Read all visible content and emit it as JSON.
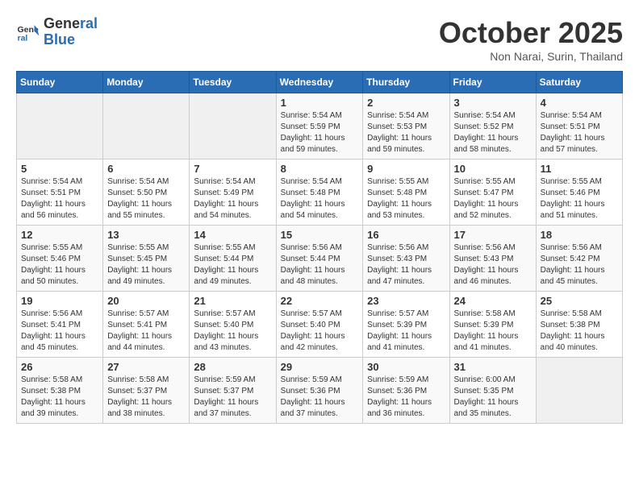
{
  "logo": {
    "line1": "General",
    "line2": "Blue"
  },
  "title": "October 2025",
  "subtitle": "Non Narai, Surin, Thailand",
  "headers": [
    "Sunday",
    "Monday",
    "Tuesday",
    "Wednesday",
    "Thursday",
    "Friday",
    "Saturday"
  ],
  "weeks": [
    [
      {
        "day": "",
        "sunrise": "",
        "sunset": "",
        "daylight": ""
      },
      {
        "day": "",
        "sunrise": "",
        "sunset": "",
        "daylight": ""
      },
      {
        "day": "",
        "sunrise": "",
        "sunset": "",
        "daylight": ""
      },
      {
        "day": "1",
        "sunrise": "Sunrise: 5:54 AM",
        "sunset": "Sunset: 5:59 PM",
        "daylight": "Daylight: 11 hours and 59 minutes."
      },
      {
        "day": "2",
        "sunrise": "Sunrise: 5:54 AM",
        "sunset": "Sunset: 5:53 PM",
        "daylight": "Daylight: 11 hours and 59 minutes."
      },
      {
        "day": "3",
        "sunrise": "Sunrise: 5:54 AM",
        "sunset": "Sunset: 5:52 PM",
        "daylight": "Daylight: 11 hours and 58 minutes."
      },
      {
        "day": "4",
        "sunrise": "Sunrise: 5:54 AM",
        "sunset": "Sunset: 5:51 PM",
        "daylight": "Daylight: 11 hours and 57 minutes."
      }
    ],
    [
      {
        "day": "5",
        "sunrise": "Sunrise: 5:54 AM",
        "sunset": "Sunset: 5:51 PM",
        "daylight": "Daylight: 11 hours and 56 minutes."
      },
      {
        "day": "6",
        "sunrise": "Sunrise: 5:54 AM",
        "sunset": "Sunset: 5:50 PM",
        "daylight": "Daylight: 11 hours and 55 minutes."
      },
      {
        "day": "7",
        "sunrise": "Sunrise: 5:54 AM",
        "sunset": "Sunset: 5:49 PM",
        "daylight": "Daylight: 11 hours and 54 minutes."
      },
      {
        "day": "8",
        "sunrise": "Sunrise: 5:54 AM",
        "sunset": "Sunset: 5:48 PM",
        "daylight": "Daylight: 11 hours and 54 minutes."
      },
      {
        "day": "9",
        "sunrise": "Sunrise: 5:55 AM",
        "sunset": "Sunset: 5:48 PM",
        "daylight": "Daylight: 11 hours and 53 minutes."
      },
      {
        "day": "10",
        "sunrise": "Sunrise: 5:55 AM",
        "sunset": "Sunset: 5:47 PM",
        "daylight": "Daylight: 11 hours and 52 minutes."
      },
      {
        "day": "11",
        "sunrise": "Sunrise: 5:55 AM",
        "sunset": "Sunset: 5:46 PM",
        "daylight": "Daylight: 11 hours and 51 minutes."
      }
    ],
    [
      {
        "day": "12",
        "sunrise": "Sunrise: 5:55 AM",
        "sunset": "Sunset: 5:46 PM",
        "daylight": "Daylight: 11 hours and 50 minutes."
      },
      {
        "day": "13",
        "sunrise": "Sunrise: 5:55 AM",
        "sunset": "Sunset: 5:45 PM",
        "daylight": "Daylight: 11 hours and 49 minutes."
      },
      {
        "day": "14",
        "sunrise": "Sunrise: 5:55 AM",
        "sunset": "Sunset: 5:44 PM",
        "daylight": "Daylight: 11 hours and 49 minutes."
      },
      {
        "day": "15",
        "sunrise": "Sunrise: 5:56 AM",
        "sunset": "Sunset: 5:44 PM",
        "daylight": "Daylight: 11 hours and 48 minutes."
      },
      {
        "day": "16",
        "sunrise": "Sunrise: 5:56 AM",
        "sunset": "Sunset: 5:43 PM",
        "daylight": "Daylight: 11 hours and 47 minutes."
      },
      {
        "day": "17",
        "sunrise": "Sunrise: 5:56 AM",
        "sunset": "Sunset: 5:43 PM",
        "daylight": "Daylight: 11 hours and 46 minutes."
      },
      {
        "day": "18",
        "sunrise": "Sunrise: 5:56 AM",
        "sunset": "Sunset: 5:42 PM",
        "daylight": "Daylight: 11 hours and 45 minutes."
      }
    ],
    [
      {
        "day": "19",
        "sunrise": "Sunrise: 5:56 AM",
        "sunset": "Sunset: 5:41 PM",
        "daylight": "Daylight: 11 hours and 45 minutes."
      },
      {
        "day": "20",
        "sunrise": "Sunrise: 5:57 AM",
        "sunset": "Sunset: 5:41 PM",
        "daylight": "Daylight: 11 hours and 44 minutes."
      },
      {
        "day": "21",
        "sunrise": "Sunrise: 5:57 AM",
        "sunset": "Sunset: 5:40 PM",
        "daylight": "Daylight: 11 hours and 43 minutes."
      },
      {
        "day": "22",
        "sunrise": "Sunrise: 5:57 AM",
        "sunset": "Sunset: 5:40 PM",
        "daylight": "Daylight: 11 hours and 42 minutes."
      },
      {
        "day": "23",
        "sunrise": "Sunrise: 5:57 AM",
        "sunset": "Sunset: 5:39 PM",
        "daylight": "Daylight: 11 hours and 41 minutes."
      },
      {
        "day": "24",
        "sunrise": "Sunrise: 5:58 AM",
        "sunset": "Sunset: 5:39 PM",
        "daylight": "Daylight: 11 hours and 41 minutes."
      },
      {
        "day": "25",
        "sunrise": "Sunrise: 5:58 AM",
        "sunset": "Sunset: 5:38 PM",
        "daylight": "Daylight: 11 hours and 40 minutes."
      }
    ],
    [
      {
        "day": "26",
        "sunrise": "Sunrise: 5:58 AM",
        "sunset": "Sunset: 5:38 PM",
        "daylight": "Daylight: 11 hours and 39 minutes."
      },
      {
        "day": "27",
        "sunrise": "Sunrise: 5:58 AM",
        "sunset": "Sunset: 5:37 PM",
        "daylight": "Daylight: 11 hours and 38 minutes."
      },
      {
        "day": "28",
        "sunrise": "Sunrise: 5:59 AM",
        "sunset": "Sunset: 5:37 PM",
        "daylight": "Daylight: 11 hours and 37 minutes."
      },
      {
        "day": "29",
        "sunrise": "Sunrise: 5:59 AM",
        "sunset": "Sunset: 5:36 PM",
        "daylight": "Daylight: 11 hours and 37 minutes."
      },
      {
        "day": "30",
        "sunrise": "Sunrise: 5:59 AM",
        "sunset": "Sunset: 5:36 PM",
        "daylight": "Daylight: 11 hours and 36 minutes."
      },
      {
        "day": "31",
        "sunrise": "Sunrise: 6:00 AM",
        "sunset": "Sunset: 5:35 PM",
        "daylight": "Daylight: 11 hours and 35 minutes."
      },
      {
        "day": "",
        "sunrise": "",
        "sunset": "",
        "daylight": ""
      }
    ]
  ]
}
